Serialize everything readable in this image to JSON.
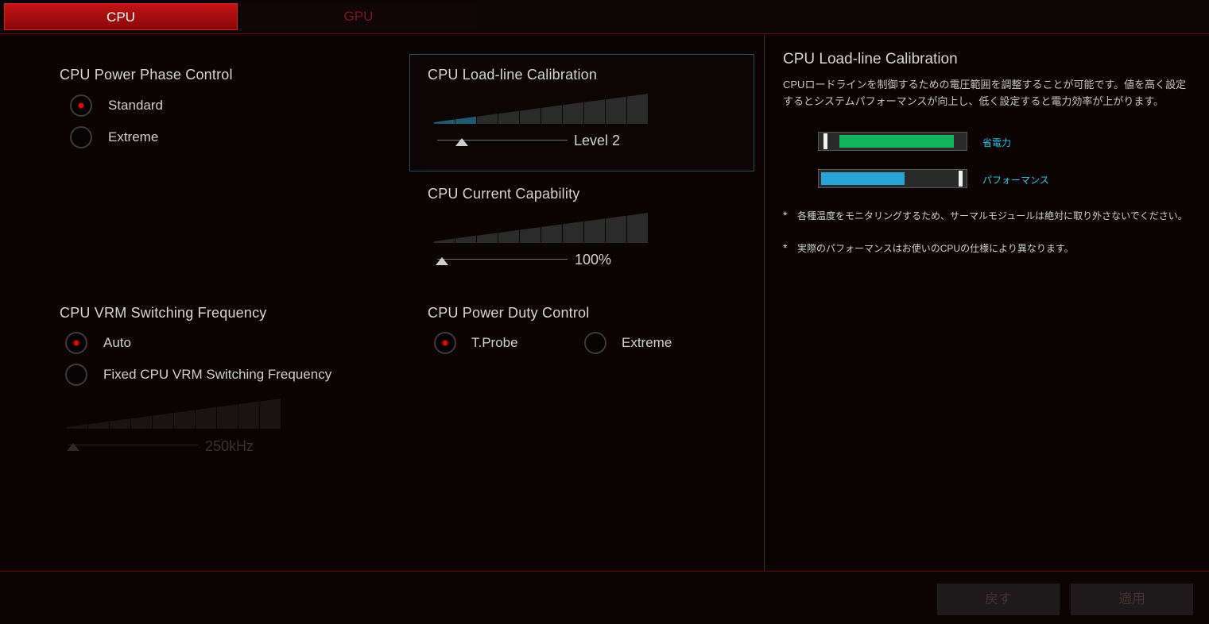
{
  "tabs": [
    {
      "label": "CPU",
      "active": true
    },
    {
      "label": "GPU",
      "active": false
    }
  ],
  "phase_control": {
    "title": "CPU Power Phase Control",
    "options": [
      "Standard",
      "Extreme"
    ],
    "selected": "Standard"
  },
  "vrm_frequency": {
    "title": "CPU VRM Switching Frequency",
    "options": [
      "Auto",
      "Fixed CPU VRM Switching Frequency"
    ],
    "selected": "Auto",
    "slider_value": "250kHz",
    "slider_enabled": false
  },
  "load_line": {
    "title": "CPU Load-line Calibration",
    "value": "Level 2",
    "level_index": 2,
    "level_count": 10
  },
  "current_capability": {
    "title": "CPU Current Capability",
    "value": "100%"
  },
  "duty_control": {
    "title": "CPU Power Duty Control",
    "options": [
      "T.Probe",
      "Extreme"
    ],
    "selected": "T.Probe"
  },
  "info_panel": {
    "title": "CPU Load-line Calibration",
    "description": "CPUロードラインを制御するための電圧範囲を調整することが可能です。値を高く設定するとシステムパフォーマンスが向上し、低く設定すると電力効率が上がります。",
    "bars": [
      {
        "label": "省電力",
        "level": 0.9,
        "color": "#12b55a"
      },
      {
        "label": "パフォーマンス",
        "level": 0.55,
        "color": "#2aa3d6"
      }
    ],
    "notes": [
      "各種温度をモニタリングするため、サーマルモジュールは絶対に取り外さないでください。",
      "実際のパフォーマンスはお使いのCPUの仕様により異なります。"
    ]
  },
  "footer": {
    "undo_label": "戻す",
    "apply_label": "適用"
  },
  "colors": {
    "accent_red": "#c01414",
    "highlight_border": "#2c4c5c",
    "info_text": "#2fc7e6"
  }
}
